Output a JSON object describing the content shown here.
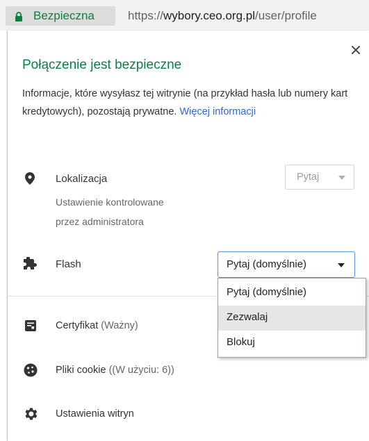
{
  "address_bar": {
    "secure_label": "Bezpieczna",
    "url_scheme": "https://",
    "url_host": "wybory.ceo.org.pl",
    "url_path": "/user/profile"
  },
  "popup": {
    "title": "Połączenie jest bezpieczne",
    "description": "Informacje, które wysyłasz tej witrynie (na przykład hasła lub numery kart kredytowych), pozostają prywatne.",
    "more_link": "Więcej informacji",
    "permissions": [
      {
        "label": "Lokalizacja",
        "sub1": "Ustawienie kontrolowane",
        "sub2": "przez administratora",
        "value": "Pytaj",
        "icon": "location-pin-icon"
      },
      {
        "label": "Flash",
        "value": "Pytaj (domyślnie)",
        "icon": "puzzle-piece-icon"
      }
    ],
    "flash_options": [
      "Pytaj (domyślnie)",
      "Zezwalaj",
      "Blokuj"
    ],
    "highlighted_option": "Zezwalaj",
    "links": [
      {
        "label": "Certyfikat",
        "detail": "(Ważny)",
        "icon": "certificate-icon"
      },
      {
        "label": "Pliki cookie",
        "detail": "((W użyciu: 6))",
        "icon": "cookie-icon"
      },
      {
        "label": "Ustawienia witryn",
        "detail": "",
        "icon": "gear-icon"
      }
    ]
  },
  "colors": {
    "secure_green": "#0b8043",
    "link_blue": "#3367d6",
    "select_focus": "#5b92e5"
  }
}
